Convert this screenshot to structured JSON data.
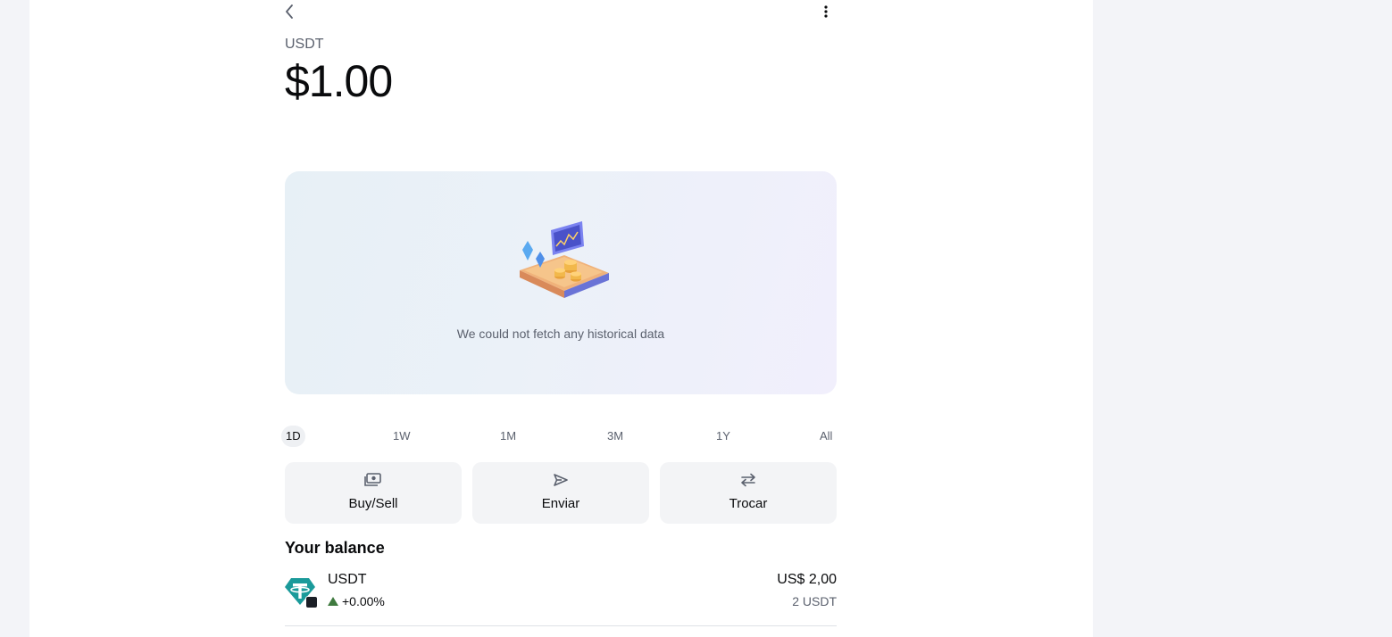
{
  "header": {
    "symbol": "USDT",
    "price": "$1.00"
  },
  "chart": {
    "empty_message": "We could not fetch any historical data"
  },
  "periods": [
    {
      "label": "1D",
      "active": true
    },
    {
      "label": "1W",
      "active": false
    },
    {
      "label": "1M",
      "active": false
    },
    {
      "label": "3M",
      "active": false
    },
    {
      "label": "1Y",
      "active": false
    },
    {
      "label": "All",
      "active": false
    }
  ],
  "actions": [
    {
      "label": "Buy/Sell",
      "icon": "cash-icon"
    },
    {
      "label": "Enviar",
      "icon": "send-icon"
    },
    {
      "label": "Trocar",
      "icon": "swap-icon"
    }
  ],
  "balance": {
    "title": "Your balance",
    "token_name": "USDT",
    "change": "+0.00%",
    "fiat_value": "US$ 2,00",
    "crypto_value": "2 USDT"
  },
  "colors": {
    "background": "#f3f4f8",
    "card_gradient_start": "#e7f0f6",
    "card_gradient_end": "#f1effc",
    "tether_green": "#1a9a9a",
    "positive": "#3f7a3f"
  }
}
